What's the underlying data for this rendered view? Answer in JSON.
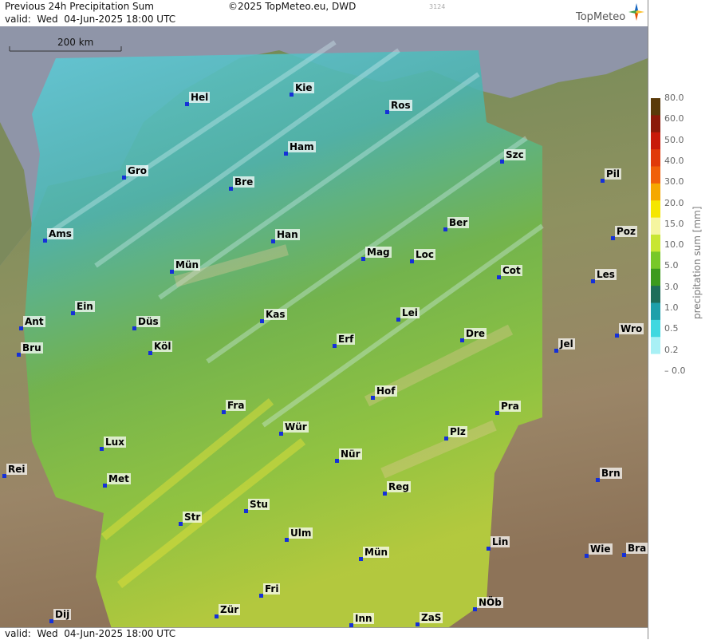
{
  "header": {
    "title": "Previous 24h Precipitation Sum",
    "valid": "valid:  Wed  04-Jun-2025 18:00 UTC",
    "copyright": "©2025 TopMeteo.eu, DWD",
    "code": "3124",
    "logo": "TopMeteo"
  },
  "footer": {
    "valid": "valid:  Wed  04-Jun-2025 18:00 UTC"
  },
  "scale": {
    "label": "200 km"
  },
  "legend": {
    "axis_label": "precipitation sum [mm]",
    "levels": [
      "80.0",
      "60.0",
      "50.0",
      "40.0",
      "30.0",
      "20.0",
      "15.0",
      "10.0",
      "5.0",
      "3.0",
      "1.0",
      "0.5",
      "0.2",
      "0.0"
    ],
    "colors": [
      "#5a3a0a",
      "#8b1a0a",
      "#c81a0a",
      "#e03a0a",
      "#f0600a",
      "#f5a800",
      "#f5e600",
      "#f5f5a0",
      "#c8e632",
      "#78c828",
      "#3c9a1e",
      "#1e6e5a",
      "#1ea0aa",
      "#40d8e0",
      "#a8f0f5",
      "#ffffff"
    ]
  },
  "cities": [
    {
      "name": "Hel"
    },
    {
      "name": "Kie"
    },
    {
      "name": "Ros"
    },
    {
      "name": "Ham"
    },
    {
      "name": "Szc"
    },
    {
      "name": "Gro"
    },
    {
      "name": "Bre"
    },
    {
      "name": "Pil"
    },
    {
      "name": "Ber"
    },
    {
      "name": "Ams"
    },
    {
      "name": "Han"
    },
    {
      "name": "Poz"
    },
    {
      "name": "Mag"
    },
    {
      "name": "Loc"
    },
    {
      "name": "Mün"
    },
    {
      "name": "Cot"
    },
    {
      "name": "Les"
    },
    {
      "name": "Ein"
    },
    {
      "name": "Kas"
    },
    {
      "name": "Lei"
    },
    {
      "name": "Ant"
    },
    {
      "name": "Düs"
    },
    {
      "name": "Wro"
    },
    {
      "name": "Erf"
    },
    {
      "name": "Dre"
    },
    {
      "name": "Bru"
    },
    {
      "name": "Köl"
    },
    {
      "name": "Jel"
    },
    {
      "name": "Hof"
    },
    {
      "name": "Fra"
    },
    {
      "name": "Pra"
    },
    {
      "name": "Wür"
    },
    {
      "name": "Plz"
    },
    {
      "name": "Lux"
    },
    {
      "name": "Nür"
    },
    {
      "name": "Rei"
    },
    {
      "name": "Brn"
    },
    {
      "name": "Met"
    },
    {
      "name": "Reg"
    },
    {
      "name": "Stu"
    },
    {
      "name": "Str"
    },
    {
      "name": "Lin"
    },
    {
      "name": "Ulm"
    },
    {
      "name": "Wie"
    },
    {
      "name": "Bra"
    },
    {
      "name": "Mün"
    },
    {
      "name": "Fri"
    },
    {
      "name": "NÖb"
    },
    {
      "name": "Zür"
    },
    {
      "name": "Dij"
    },
    {
      "name": "Inn"
    },
    {
      "name": "ZaS"
    }
  ]
}
